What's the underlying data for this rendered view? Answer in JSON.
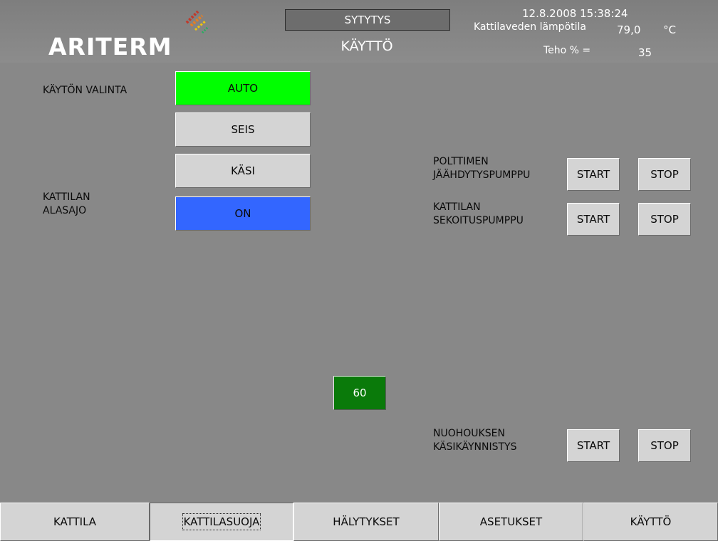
{
  "header": {
    "logo_text": "ARITERM",
    "mode_box": "SYTYTYS",
    "mode_text": "KÄYTTÖ",
    "datetime": "12.8.2008 15:38:24",
    "water_temp_label": "Kattilaveden lämpötila",
    "water_temp_value": "79,0",
    "water_temp_unit": "°C",
    "power_label": "Teho % =",
    "power_value": "35"
  },
  "left": {
    "mode_select_label": "KÄYTÖN VALINTA",
    "auto_label": "AUTO",
    "seis_label": "SEIS",
    "kasi_label": "KÄSI",
    "alasajo_label_1": "KATTILAN",
    "alasajo_label_2": "ALASAJO",
    "on_label": "ON"
  },
  "pumps": {
    "burner_label_1": "POLTTIMEN",
    "burner_label_2": "JÄÄHDYTYSPUMPPU",
    "mixing_label_1": "KATTILAN",
    "mixing_label_2": "SEKOITUSPUMPPU",
    "sooting_label_1": "NUOHOUKSEN",
    "sooting_label_2": "KÄSIKÄYNNISTYS",
    "start_label": "START",
    "stop_label": "STOP"
  },
  "counter_value": "60",
  "nav": {
    "tabs": [
      "KATTILA",
      "KATTILASUOJA",
      "HÄLYTYKSET",
      "ASETUKSET",
      "KÄYTTÖ"
    ],
    "active_tab": "KATTILASUOJA"
  },
  "colors": {
    "auto_active": "#00ff00",
    "on_active": "#3366ff",
    "counter": "#0a7a0a",
    "background": "#888888"
  }
}
